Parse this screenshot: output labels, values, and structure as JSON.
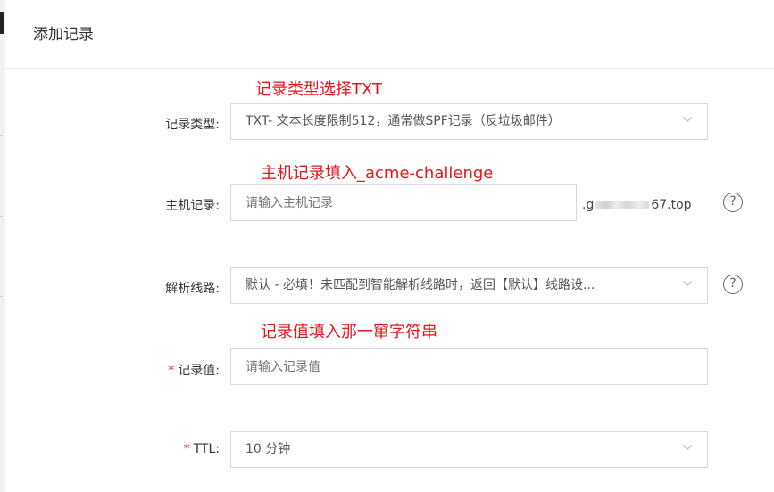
{
  "dialog": {
    "title": "添加记录"
  },
  "annotations": {
    "record_type": "记录类型选择TXT",
    "host": "主机记录填入_acme-challenge",
    "value": "记录值填入那一窜字符串"
  },
  "form": {
    "record_type": {
      "label": "记录类型:",
      "value": "TXT- 文本长度限制512，通常做SPF记录（反垃圾邮件）"
    },
    "host": {
      "label": "主机记录:",
      "placeholder": "请输入主机记录",
      "suffix_start": ".g",
      "suffix_end": "67.top"
    },
    "line": {
      "label": "解析线路:",
      "value": "默认 - 必填！未匹配到智能解析线路时，返回【默认】线路设..."
    },
    "record_value": {
      "required": "*",
      "label": "记录值:",
      "placeholder": "请输入记录值"
    },
    "ttl": {
      "required": "*",
      "label": "TTL:",
      "value": "10 分钟"
    }
  },
  "icons": {
    "help": "help-circle-icon",
    "dropdown": "chevron-down-icon"
  },
  "colors": {
    "annotation": "#e8151b",
    "required": "#e8151b",
    "border": "#d9d9d9"
  }
}
